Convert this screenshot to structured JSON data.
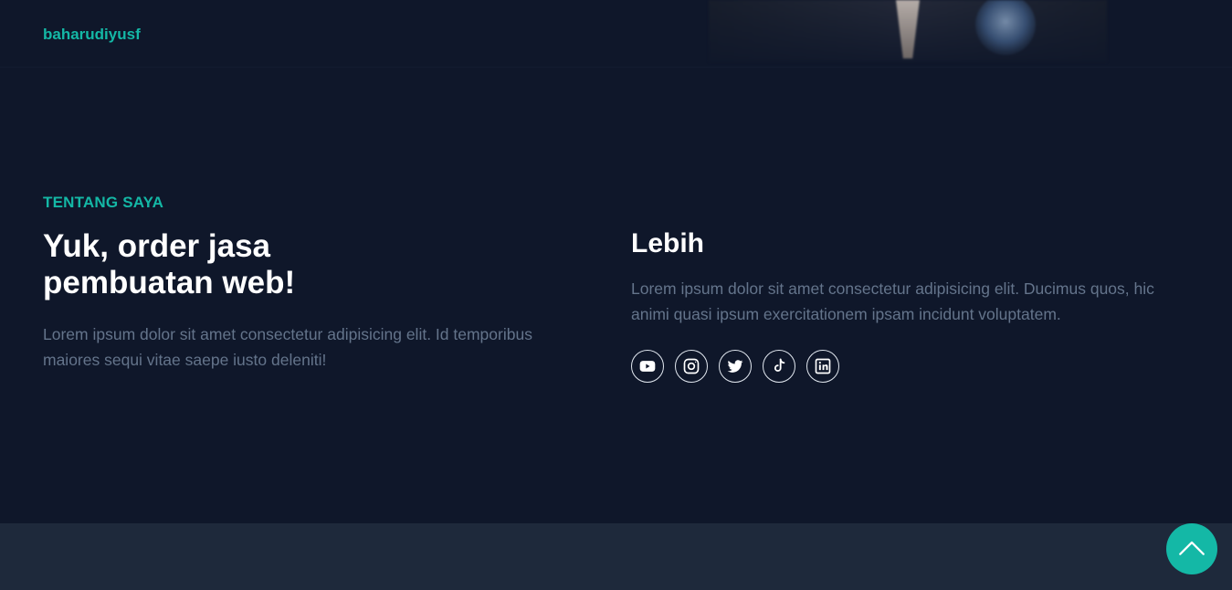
{
  "header": {
    "brand": "baharudiyusf"
  },
  "about": {
    "eyebrow": "TENTANG SAYA",
    "headline": "Yuk, order jasa pembuatan web!",
    "text": "Lorem ipsum dolor sit amet consectetur adipisicing elit. Id temporibus maiores sequi vitae saepe iusto deleniti!"
  },
  "more": {
    "title": "Lebih",
    "text": "Lorem ipsum dolor sit amet consectetur adipisicing elit. Ducimus quos, hic animi quasi ipsum exercitationem ipsam incidunt voluptatem.",
    "socials": [
      {
        "icon": "youtube-icon"
      },
      {
        "icon": "instagram-icon"
      },
      {
        "icon": "twitter-icon"
      },
      {
        "icon": "tiktok-icon"
      },
      {
        "icon": "linkedin-icon"
      }
    ]
  },
  "colors": {
    "background": "#0f172a",
    "accent": "#14b8a6",
    "muted_text": "#64748b",
    "footer": "#1e293b"
  }
}
